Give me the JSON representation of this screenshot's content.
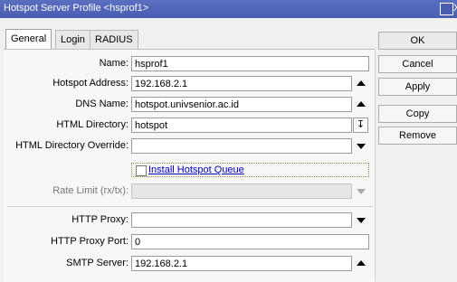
{
  "window": {
    "title": "Hotspot Server Profile <hsprof1>"
  },
  "tabs": [
    {
      "label": "General"
    },
    {
      "label": "Login"
    },
    {
      "label": "RADIUS"
    }
  ],
  "buttons": {
    "ok": "OK",
    "cancel": "Cancel",
    "apply": "Apply",
    "copy": "Copy",
    "remove": "Remove"
  },
  "form": {
    "name": {
      "label": "Name:",
      "value": "hsprof1"
    },
    "hotspot_address": {
      "label": "Hotspot Address:",
      "value": "192.168.2.1"
    },
    "dns_name": {
      "label": "DNS Name:",
      "value": "hotspot.univsenior.ac.id"
    },
    "html_directory": {
      "label": "HTML Directory:",
      "value": "hotspot"
    },
    "html_directory_override": {
      "label": "HTML Directory Override:",
      "value": ""
    },
    "install_queue": {
      "label": "Install Hotspot Queue",
      "checked": false
    },
    "rate_limit": {
      "label": "Rate Limit (rx/tx):",
      "value": ""
    },
    "http_proxy": {
      "label": "HTTP Proxy:",
      "value": ""
    },
    "http_proxy_port": {
      "label": "HTTP Proxy Port:",
      "value": "0"
    },
    "smtp_server": {
      "label": "SMTP Server:",
      "value": "192.168.2.1"
    }
  }
}
